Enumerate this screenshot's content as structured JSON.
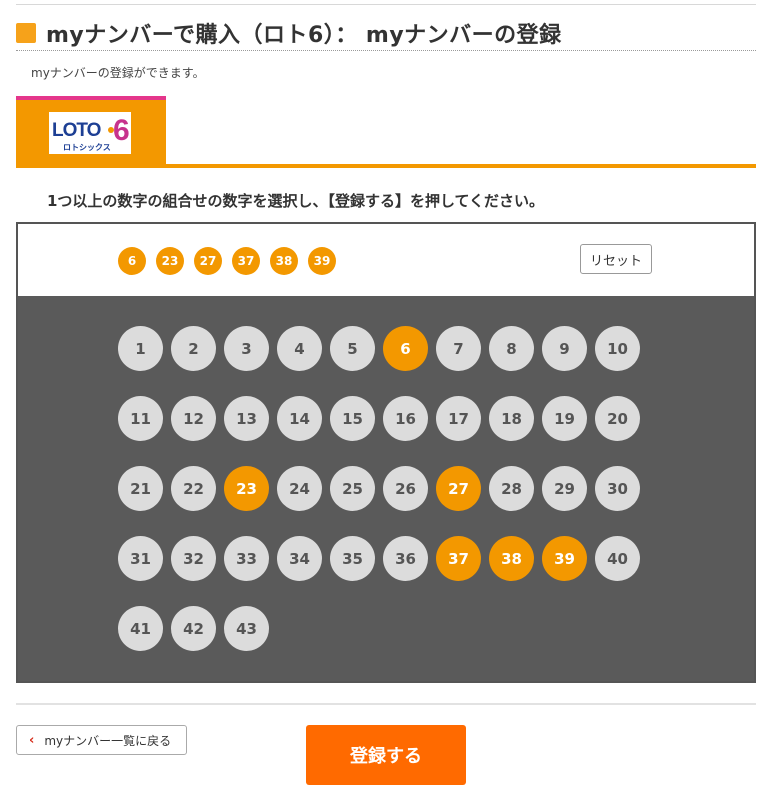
{
  "header": {
    "title": "myナンバーで購入（ロト6）： myナンバーの登録",
    "description": "myナンバーの登録ができます。"
  },
  "tab": {
    "logo_text": "LOTO 6",
    "logo_subtext": "ロトシックス"
  },
  "instruction": "1つ以上の数字の組合せの数字を選択し、【登録する】を押してください。",
  "selection": {
    "selected": [
      "6",
      "23",
      "27",
      "37",
      "38",
      "39"
    ],
    "reset_label": "リセット"
  },
  "numbers": [
    "1",
    "2",
    "3",
    "4",
    "5",
    "6",
    "7",
    "8",
    "9",
    "10",
    "11",
    "12",
    "13",
    "14",
    "15",
    "16",
    "17",
    "18",
    "19",
    "20",
    "21",
    "22",
    "23",
    "24",
    "25",
    "26",
    "27",
    "28",
    "29",
    "30",
    "31",
    "32",
    "33",
    "34",
    "35",
    "36",
    "37",
    "38",
    "39",
    "40",
    "41",
    "42",
    "43"
  ],
  "footer": {
    "back_label": "myナンバー一覧に戻る",
    "submit_label": "登録する"
  },
  "colors": {
    "accent": "#f39800",
    "submit": "#ff6a00",
    "tab_top": "#e4368b",
    "panel": "#5a5a5a"
  }
}
